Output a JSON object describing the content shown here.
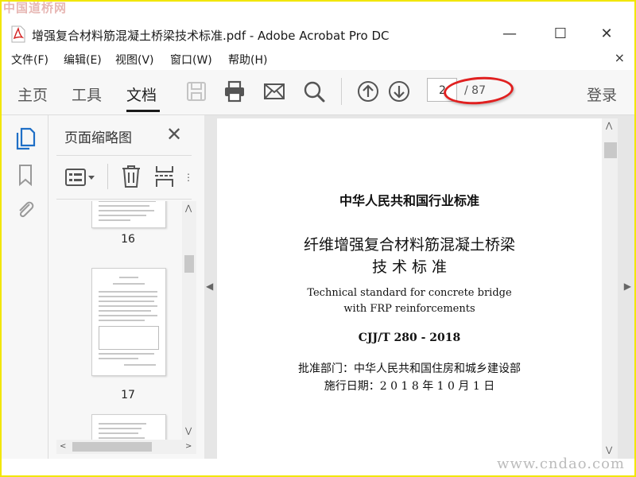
{
  "watermark": {
    "top": "中国道桥网",
    "bottom": "www.cndao.com"
  },
  "window": {
    "title": "增强复合材料筋混凝土桥梁技术标准.pdf - Adobe Acrobat Pro DC",
    "minimize": "—",
    "maximize": "☐",
    "close": "✕"
  },
  "menu": {
    "items": [
      "文件(F)",
      "编辑(E)",
      "视图(V)",
      "窗口(W)",
      "帮助(H)"
    ],
    "close": "×"
  },
  "toolbar": {
    "tabs": [
      "主页",
      "工具",
      "文档"
    ],
    "page_current": "2",
    "page_total": "/ 87",
    "login": "登录",
    "icons": [
      "save-icon",
      "print-icon",
      "email-icon",
      "search-icon",
      "page-up-icon",
      "page-down-icon"
    ]
  },
  "leftstrip": {
    "icons": [
      "page-thumbnails-icon",
      "bookmark-icon",
      "attachment-icon"
    ]
  },
  "thumbnail_panel": {
    "title": "页面缩略图",
    "close": "✕",
    "thumbnails": [
      {
        "label": "16"
      },
      {
        "label": "17"
      }
    ]
  },
  "document": {
    "line1": "中华人民共和国行业标准",
    "line2": "纤维增强复合材料筋混凝土桥梁",
    "line3": "技 术 标 准",
    "line4": "Technical standard for concrete bridge",
    "line5": "with FRP reinforcements",
    "line6": "CJJ/T 280 - 2018",
    "line7": "批准部门：中华人民共和国住房和城乡建设部",
    "line8": "施行日期：2 0 1 8 年 1 0 月 1 日"
  }
}
